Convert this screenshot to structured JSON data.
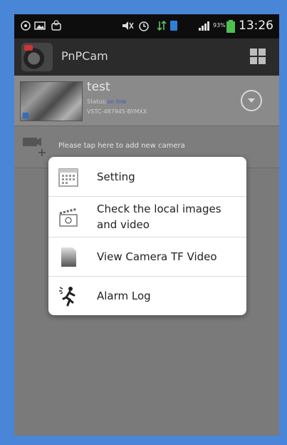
{
  "status_bar": {
    "battery_percent": "93%",
    "time": "13:26"
  },
  "action_bar": {
    "title": "PnPCam"
  },
  "camera": {
    "name": "test",
    "status_prefix": "Status:",
    "status_value": "on line",
    "uid": "VSTC-487945-BYMXX"
  },
  "add_camera": {
    "label": "Please tap here to add new camera"
  },
  "menu": {
    "items": [
      {
        "label": "Setting"
      },
      {
        "label": "Check the local images\nand video"
      },
      {
        "label": "View Camera TF Video"
      },
      {
        "label": "Alarm Log"
      }
    ]
  },
  "colors": {
    "frame": "#4a86d8",
    "status_online": "#3a5cc0"
  }
}
